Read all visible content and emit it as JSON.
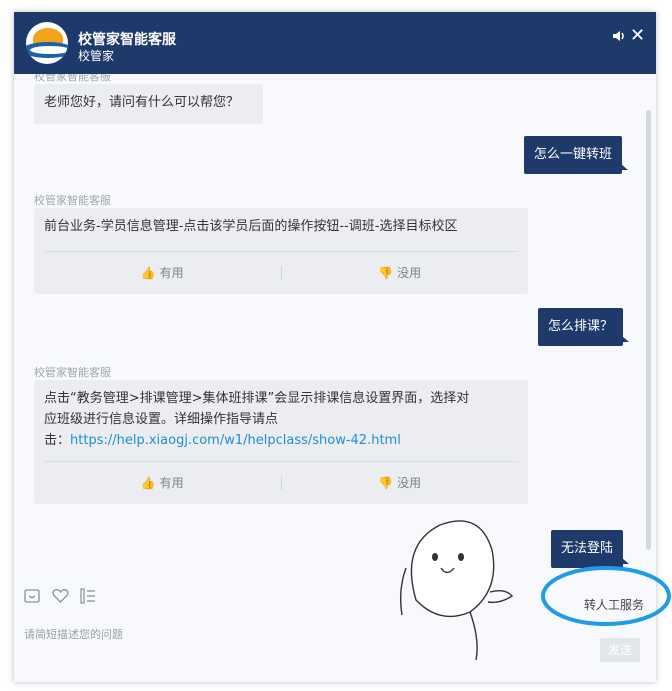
{
  "header": {
    "title": "校管家智能客服",
    "subtitle": "校管家",
    "volume_icon": "volume-icon",
    "close_icon": "✕"
  },
  "messages": [
    {
      "role": "bot",
      "text": "老师您好，请问有什么可以帮您？"
    },
    {
      "role": "user",
      "text": "怎么一键转班"
    },
    {
      "role": "bot",
      "sender": "校管家智能客服",
      "text": "前台业务-学员信息管理-点击该学员后面的操作按钮--调班-选择目标校区",
      "useful": "有用",
      "useless": "没用"
    },
    {
      "role": "user",
      "text": "怎么排课？"
    },
    {
      "role": "bot",
      "sender": "校管家智能客服",
      "text_line1": "点击“教务管理>排课管理>集体班排课”会显示排课信息设置界面，选择对",
      "text_line2": "应班级进行信息设置。详细操作指导请点",
      "text_prefix": "击：",
      "link": "https://help.xiaogj.com/w1/helpclass/show-42.html",
      "useful": "有用",
      "useless": "没用"
    },
    {
      "role": "user",
      "text": "无法登陆"
    }
  ],
  "toolbar": {
    "icons": [
      "emoji-icon",
      "heart-icon",
      "list-icon"
    ],
    "placeholder": "请简短描述您的问题",
    "transfer_label": "转人工服务",
    "send_label": "发送"
  },
  "colors": {
    "header": "#1e3a6a",
    "link": "#1e8fd6",
    "highlight_circle": "#1f9be8"
  }
}
